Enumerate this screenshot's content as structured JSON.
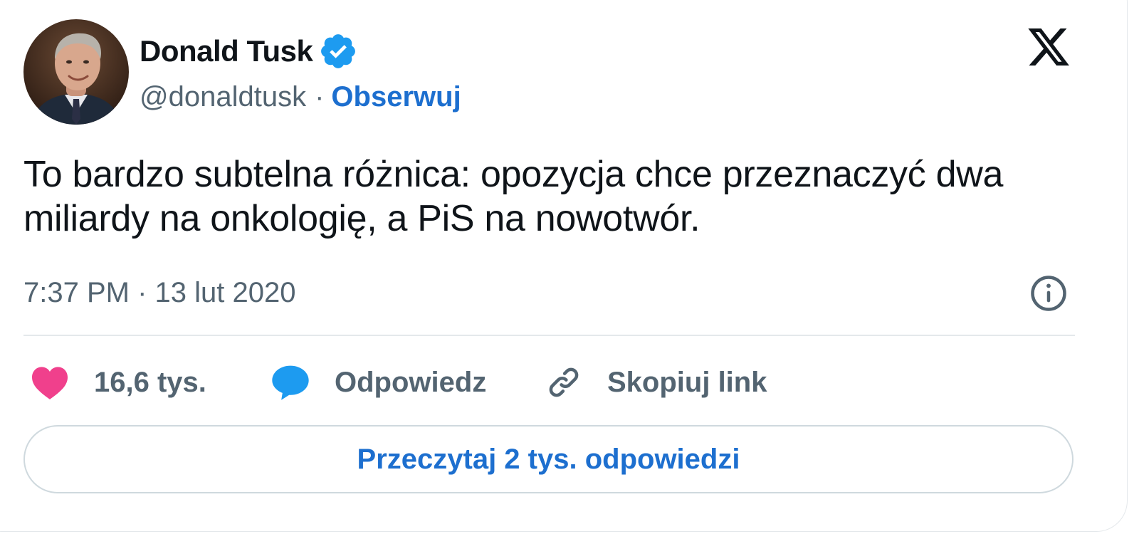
{
  "author": {
    "display_name": "Donald Tusk",
    "handle": "@donaldtusk",
    "separator": "·",
    "follow_label": "Obserwuj",
    "verified": true
  },
  "tweet": {
    "text": "To bardzo subtelna różnica: opozycja chce przeznaczyć dwa miliardy na onkologię, a PiS na nowotwór.",
    "timestamp": "7:37 PM · 13 lut 2020"
  },
  "actions": {
    "like_count": "16,6 tys.",
    "reply_label": "Odpowiedz",
    "copy_link_label": "Skopiuj link"
  },
  "read_replies_label": "Przeczytaj 2 tys. odpowiedzi",
  "icons": {
    "platform": "x-logo-icon",
    "verified": "verified-badge-icon",
    "info": "info-icon",
    "like": "heart-icon",
    "reply": "speech-bubble-icon",
    "copy": "link-icon"
  },
  "colors": {
    "text_primary": "#0f1419",
    "text_secondary": "#536471",
    "accent_blue": "#1d6fcf",
    "verified_blue": "#1d9bf0",
    "like_pink": "#f0408c",
    "reply_blue": "#1d9bf0",
    "border": "#cfd9de"
  }
}
